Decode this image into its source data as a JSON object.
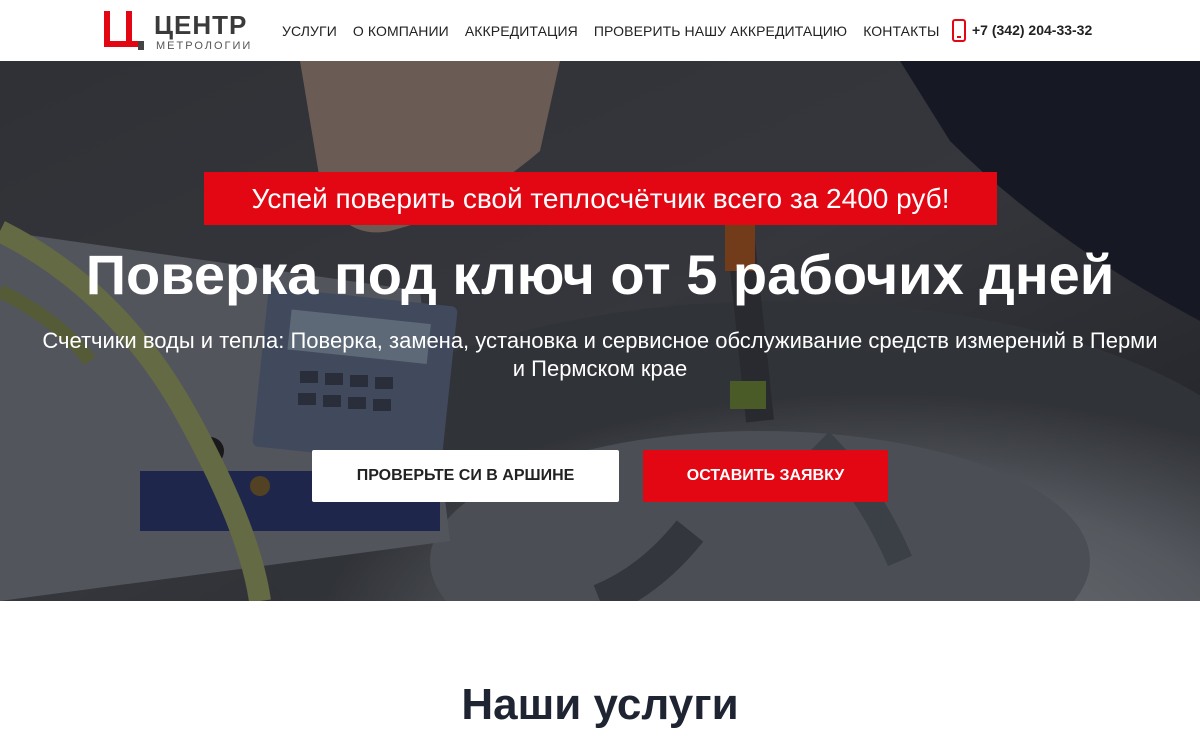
{
  "header": {
    "logo": {
      "title": "ЦЕНТР",
      "subtitle": "МЕТРОЛОГИИ"
    },
    "nav": [
      {
        "label": "УСЛУГИ"
      },
      {
        "label": "О КОМПАНИИ"
      },
      {
        "label": "АККРЕДИТАЦИЯ"
      },
      {
        "label": "ПРОВЕРИТЬ НАШУ АККРЕДИТАЦИЮ"
      },
      {
        "label": "КОНТАКТЫ"
      }
    ],
    "phone": {
      "icon": "phone-icon",
      "number": "+7 (342) 204-33-32"
    }
  },
  "hero": {
    "promo": "Успей поверить свой теплосчётчик всего за 2400 руб!",
    "title": "Поверка под ключ от 5 рабочих дней",
    "subtitle": "Счетчики воды и тепла: Поверка, замена, установка и сервисное обслуживание средств измерений в Перми и Пермском крае",
    "buttons": {
      "check": "ПРОВЕРЬТЕ СИ В АРШИНЕ",
      "request": "ОСТАВИТЬ ЗАЯВКУ"
    }
  },
  "services": {
    "title": "Наши услуги"
  },
  "colors": {
    "accent": "#e30613",
    "heading": "#1f2433"
  }
}
